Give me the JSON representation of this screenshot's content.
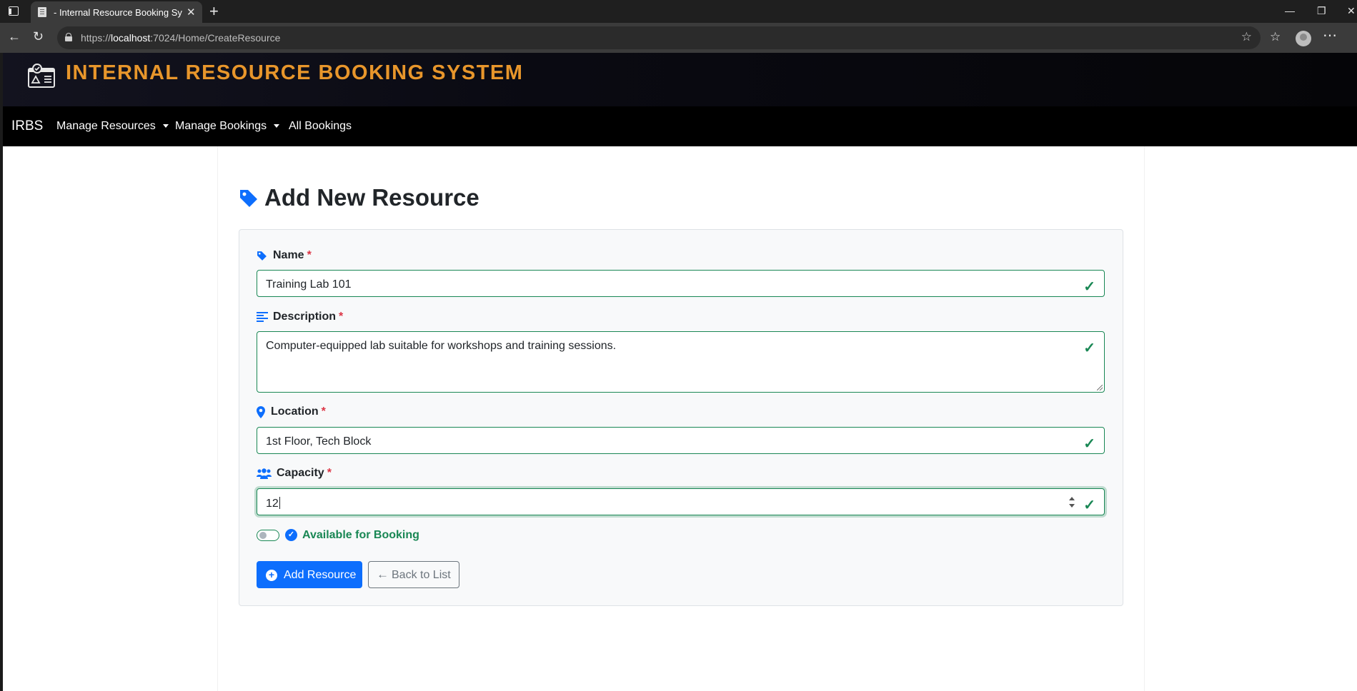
{
  "browser": {
    "tab_title": "- Internal Resource Booking System",
    "url_scheme": "https://",
    "url_host": "localhost",
    "url_path": ":7024/Home/CreateResource"
  },
  "header": {
    "title": "INTERNAL RESOURCE BOOKING SYSTEM"
  },
  "nav": {
    "brand": "IRBS",
    "items": [
      {
        "label": "Manage Resources",
        "dropdown": true
      },
      {
        "label": "Manage Bookings",
        "dropdown": true
      },
      {
        "label": "All Bookings",
        "dropdown": false
      }
    ]
  },
  "page": {
    "title": "Add New Resource"
  },
  "form": {
    "name": {
      "label": "Name",
      "required_mark": "*",
      "value": "Training Lab 101"
    },
    "description": {
      "label": "Description",
      "required_mark": "*",
      "value": "Computer-equipped lab suitable for workshops and training sessions."
    },
    "location": {
      "label": "Location",
      "required_mark": "*",
      "value": "1st Floor, Tech Block"
    },
    "capacity": {
      "label": "Capacity",
      "required_mark": "*",
      "value": "12"
    },
    "available": {
      "label": "Available for Booking",
      "checked": false
    },
    "submit_label": "Add Resource",
    "back_label": "Back to List"
  },
  "colors": {
    "accent": "#0d6efd",
    "valid": "#198754",
    "required": "#dc3545",
    "brand_title": "#e8962b"
  }
}
